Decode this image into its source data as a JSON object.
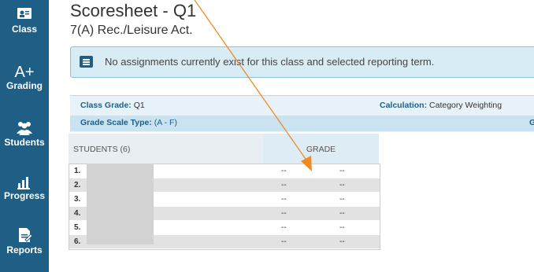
{
  "sidebar": {
    "items": [
      {
        "label": "Class",
        "icon": "class-icon"
      },
      {
        "label": "Grading",
        "icon": "grading-icon",
        "icon_text": "A+"
      },
      {
        "label": "Students",
        "icon": "students-icon"
      },
      {
        "label": "Progress",
        "icon": "progress-icon"
      },
      {
        "label": "Reports",
        "icon": "reports-icon"
      }
    ]
  },
  "page": {
    "title": "Scoresheet - Q1",
    "subtitle": "7(A) Rec./Leisure Act."
  },
  "alert": {
    "text": "No assignments currently exist for this class and selected reporting term."
  },
  "info": {
    "class_grade_label": "Class Grade:",
    "class_grade_value": "Q1",
    "calculation_label": "Calculation:",
    "calculation_value": "Category Weighting",
    "grade_scale_label": "Grade Scale Type:",
    "grade_scale_value": "(A - F)",
    "truncated_label": "G"
  },
  "table": {
    "students_header": "STUDENTS (6)",
    "grade_header": "GRADE",
    "rows": [
      {
        "num": "1.",
        "grade1": "--",
        "grade2": "--"
      },
      {
        "num": "2.",
        "grade1": "--",
        "grade2": "--"
      },
      {
        "num": "3.",
        "grade1": "--",
        "grade2": "--"
      },
      {
        "num": "4.",
        "grade1": "--",
        "grade2": "--"
      },
      {
        "num": "5.",
        "grade1": "--",
        "grade2": "--"
      },
      {
        "num": "6.",
        "grade1": "--",
        "grade2": "--"
      }
    ]
  },
  "colors": {
    "sidebar": "#1f5f86",
    "annotation_arrow": "#f08a24"
  }
}
